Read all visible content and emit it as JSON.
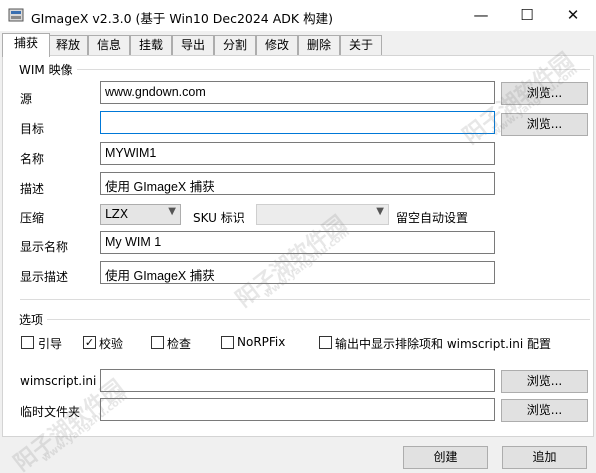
{
  "window": {
    "title": "GImageX v2.3.0 (基于 Win10 Dec2024 ADK 构建)",
    "min_glyph": "—",
    "max_glyph": "☐",
    "close_glyph": "✕"
  },
  "tabs": [
    "捕获",
    "释放",
    "信息",
    "挂载",
    "导出",
    "分割",
    "修改",
    "删除",
    "关于"
  ],
  "active_tab": "捕获",
  "wim_group": {
    "title": "WIM 映像",
    "source_label": "源",
    "source_value": "www.gndown.com",
    "target_label": "目标",
    "target_value": "",
    "name_label": "名称",
    "name_value": "MYWIM1",
    "desc_label": "描述",
    "desc_value": "使用 GImageX 捕获",
    "compress_label": "压缩",
    "compress_value": "LZX",
    "sku_label": "SKU 标识",
    "sku_value": "",
    "auto_setting_label": "留空自动设置",
    "display_name_label": "显示名称",
    "display_name_value": "My WIM 1",
    "display_desc_label": "显示描述",
    "display_desc_value": "使用 GImageX 捕获"
  },
  "browse_label": "浏览...",
  "options_group": {
    "title": "选项",
    "checkboxes": [
      {
        "label": "引导",
        "checked": false
      },
      {
        "label": "校验",
        "checked": true
      },
      {
        "label": "检查",
        "checked": false
      },
      {
        "label": "NoRPFix",
        "checked": false
      },
      {
        "label": "输出中显示排除项和 wimscript.ini 配置",
        "checked": false
      }
    ],
    "wimscript_label": "wimscript.ini",
    "wimscript_value": "",
    "temp_label": "临时文件夹",
    "temp_value": ""
  },
  "footer": {
    "create_label": "创建",
    "append_label": "追加"
  },
  "watermark": {
    "text": "阳子湖软件园",
    "url": "www.yangzhu.com"
  }
}
